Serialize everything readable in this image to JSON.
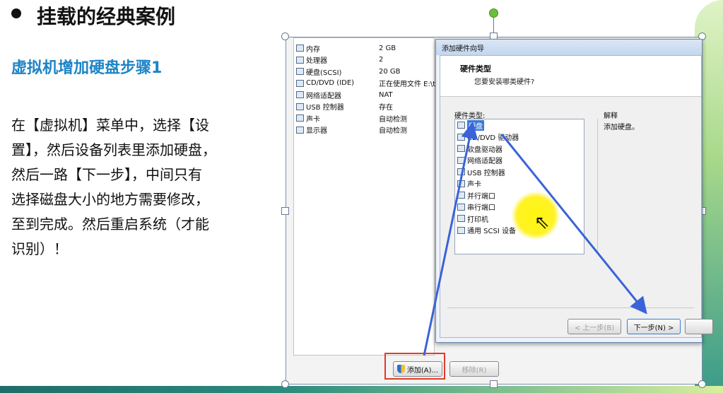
{
  "slide": {
    "title": "挂载的经典案例",
    "subtitle": "虚拟机增加硬盘步骤1",
    "description_lines": [
      "在【虚拟机】菜单中，选择【设",
      "置】，然后设备列表里添加硬盘，",
      "然后一路【下一步】，中间只有",
      "选择磁盘大小的地方需要修改，",
      "至到完成。然后重启系统（才能",
      "识别）！"
    ]
  },
  "settings": {
    "devices": [
      {
        "name": "内存",
        "summary": "2 GB",
        "icon": "memory-icon"
      },
      {
        "name": "处理器",
        "summary": "2",
        "icon": "cpu-icon"
      },
      {
        "name": "硬盘(SCSI)",
        "summary": "20 GB",
        "icon": "harddisk-icon"
      },
      {
        "name": "CD/DVD (IDE)",
        "summary": "正在使用文件 E:\\too",
        "icon": "cd-icon"
      },
      {
        "name": "网络适配器",
        "summary": "NAT",
        "icon": "network-icon"
      },
      {
        "name": "USB 控制器",
        "summary": "存在",
        "icon": "usb-icon"
      },
      {
        "name": "声卡",
        "summary": "自动检测",
        "icon": "sound-icon"
      },
      {
        "name": "显示器",
        "summary": "自动检测",
        "icon": "display-icon"
      }
    ],
    "add_button": "添加(A)...",
    "remove_button": "移除(R)"
  },
  "wizard": {
    "window_title": "添加硬件向导",
    "header_title": "硬件类型",
    "header_subtitle": "您要安装哪类硬件?",
    "list_label": "硬件类型:",
    "items": [
      {
        "name": "硬盘",
        "icon": "harddisk-icon",
        "selected": true
      },
      {
        "name": "CD/DVD 驱动器",
        "icon": "cd-icon",
        "selected": false
      },
      {
        "name": "软盘驱动器",
        "icon": "floppy-icon",
        "selected": false
      },
      {
        "name": "网络适配器",
        "icon": "network-icon",
        "selected": false
      },
      {
        "name": "USB 控制器",
        "icon": "usb-icon",
        "selected": false
      },
      {
        "name": "声卡",
        "icon": "sound-icon",
        "selected": false
      },
      {
        "name": "并行端口",
        "icon": "parallel-port-icon",
        "selected": false
      },
      {
        "name": "串行端口",
        "icon": "serial-port-icon",
        "selected": false
      },
      {
        "name": "打印机",
        "icon": "printer-icon",
        "selected": false
      },
      {
        "name": "通用 SCSI 设备",
        "icon": "scsi-icon",
        "selected": false
      }
    ],
    "explain_label": "解释",
    "explain_text": "添加硬盘。",
    "back_button": "< 上一步(B)",
    "next_button": "下一步(N) >"
  },
  "colors": {
    "subtitle": "#1d84c6",
    "highlight_box": "#e23a2a",
    "arrow": "#3a63d8",
    "selection": "#3d7ad6"
  }
}
